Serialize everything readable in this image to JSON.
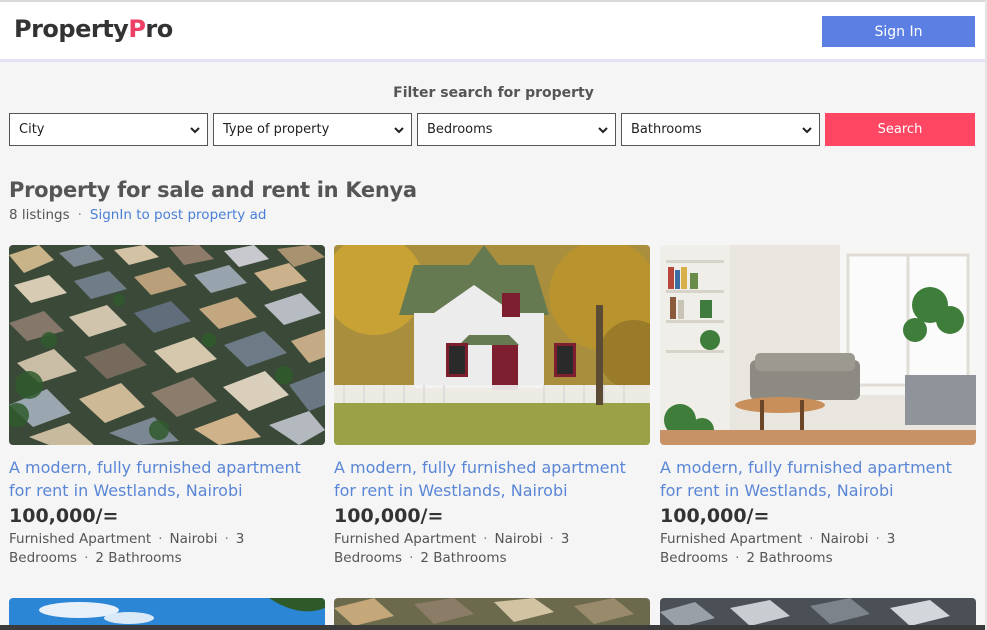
{
  "brand": {
    "name_part1": "Property",
    "name_accent": "P",
    "name_part2": "ro",
    "accent_color": "#ee3f64"
  },
  "header": {
    "signin_label": "Sign In",
    "signin_color": "#5b7fe3"
  },
  "filters": {
    "title": "Filter search for property",
    "city": "City",
    "type": "Type of property",
    "bedrooms": "Bedrooms",
    "bathrooms": "Bathrooms",
    "search_label": "Search",
    "search_color": "#ff4663"
  },
  "main": {
    "title": "Property for sale and rent in Kenya",
    "count": "8 listings",
    "separator": "·",
    "post_link": "SignIn to post property ad"
  },
  "listings": [
    {
      "image": "aerial-houses-photo",
      "title": "A modern, fully furnished apartment for rent in Westlands, Nairobi",
      "price": "100,000/=",
      "type": "Furnished Apartment",
      "city": "Nairobi",
      "beds": "3 Bedrooms",
      "baths": "2 Bathrooms"
    },
    {
      "image": "white-house-photo",
      "title": "A modern, fully furnished apartment for rent in Westlands, Nairobi",
      "price": "100,000/=",
      "type": "Furnished Apartment",
      "city": "Nairobi",
      "beds": "3 Bedrooms",
      "baths": "2 Bathrooms"
    },
    {
      "image": "living-room-photo",
      "title": "A modern, fully furnished apartment for rent in Westlands, Nairobi",
      "price": "100,000/=",
      "type": "Furnished Apartment",
      "city": "Nairobi",
      "beds": "3 Bedrooms",
      "baths": "2 Bathrooms"
    }
  ]
}
